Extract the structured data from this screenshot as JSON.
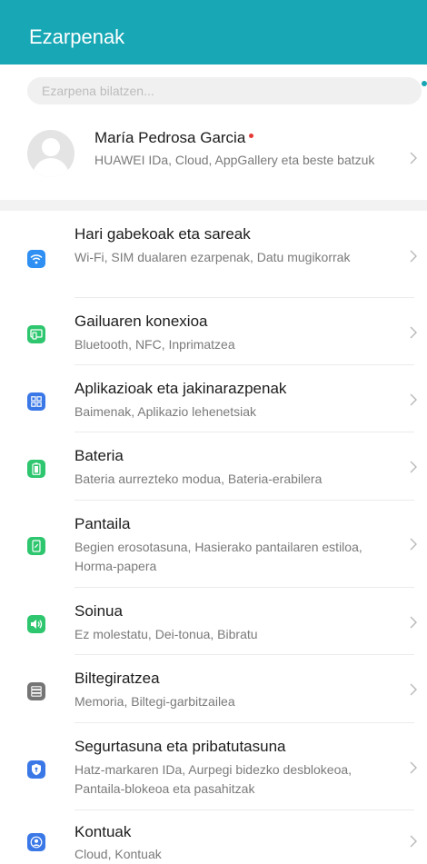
{
  "header": {
    "title": "Ezarpenak",
    "color": "#17a7b5"
  },
  "search": {
    "placeholder": "Ezarpena bilatzen..."
  },
  "profile": {
    "name": "María Pedrosa Garcia",
    "description": "HUAWEI IDa, Cloud, AppGallery eta beste batzuk"
  },
  "settings": [
    {
      "label": "Hari gabekoak eta sareak",
      "description": "Wi-Fi, SIM dualaren ezarpenak, Datu mugikorrak",
      "icon": "wifi-icon",
      "color": "#2f8ff2"
    },
    {
      "label": "Gailuaren konexioa",
      "description": "Bluetooth, NFC, Inprimatzea",
      "icon": "device-connection-icon",
      "color": "#2ec66e"
    },
    {
      "label": "Aplikazioak eta jakinarazpenak",
      "description": "Baimenak, Aplikazio lehenetsiak",
      "icon": "apps-icon",
      "color": "#3b78e7"
    },
    {
      "label": "Bateria",
      "description": "Bateria aurrezteko modua, Bateria-erabilera",
      "icon": "battery-icon",
      "color": "#2ec66e"
    },
    {
      "label": "Pantaila",
      "description": "Begien erosotasuna, Hasierako pantailaren estiloa, Horma-papera",
      "icon": "display-icon",
      "color": "#2ec66e"
    },
    {
      "label": "Soinua",
      "description": "Ez molestatu, Dei-tonua, Bibratu",
      "icon": "sound-icon",
      "color": "#2ec66e"
    },
    {
      "label": "Biltegiratzea",
      "description": "Memoria, Biltegi-garbitzailea",
      "icon": "storage-icon",
      "color": "#757575"
    },
    {
      "label": "Segurtasuna eta pribatutasuna",
      "description": "Hatz-markaren IDa, Aurpegi bidezko desblokeoa, Pantaila-blokeoa eta pasahitzak",
      "icon": "shield-icon",
      "color": "#3b78e7"
    },
    {
      "label": "Kontuak",
      "description": "Cloud, Kontuak",
      "icon": "account-icon",
      "color": "#3b78e7"
    }
  ]
}
